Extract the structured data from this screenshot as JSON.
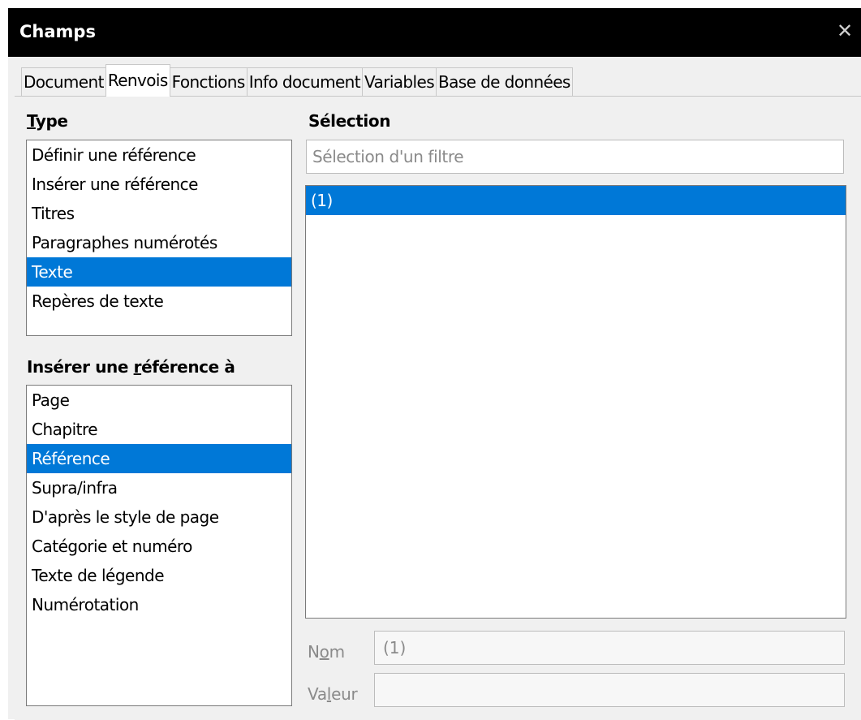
{
  "window": {
    "title": "Champs",
    "close_icon": "close-icon"
  },
  "tabs": [
    {
      "label": "Document",
      "active": false
    },
    {
      "label": "Renvois",
      "active": true
    },
    {
      "label": "Fonctions",
      "active": false
    },
    {
      "label": "Info document",
      "active": false
    },
    {
      "label": "Variables",
      "active": false
    },
    {
      "label": "Base de données",
      "active": false
    }
  ],
  "type_section": {
    "label_underlined": "T",
    "label_rest": "ype",
    "items": [
      {
        "label": "Définir une référence",
        "selected": false
      },
      {
        "label": "Insérer une référence",
        "selected": false
      },
      {
        "label": "Titres",
        "selected": false
      },
      {
        "label": "Paragraphes numérotés",
        "selected": false
      },
      {
        "label": "Texte",
        "selected": true
      },
      {
        "label": "Repères de texte",
        "selected": false
      }
    ]
  },
  "insert_ref_section": {
    "label_before": "Insérer une ",
    "label_underlined": "r",
    "label_after": "éférence à",
    "items": [
      {
        "label": "Page",
        "selected": false
      },
      {
        "label": "Chapitre",
        "selected": false
      },
      {
        "label": "Référence",
        "selected": true
      },
      {
        "label": "Supra/infra",
        "selected": false
      },
      {
        "label": "D'après le style de page",
        "selected": false
      },
      {
        "label": "Catégorie et numéro",
        "selected": false
      },
      {
        "label": "Texte de légende",
        "selected": false
      },
      {
        "label": "Numérotation",
        "selected": false
      }
    ]
  },
  "selection_section": {
    "label": "Sélection",
    "filter_placeholder": "Sélection d'un filtre",
    "items": [
      {
        "label": "(1)",
        "selected": true
      }
    ]
  },
  "fields": {
    "name_label_before": "N",
    "name_label_underlined": "o",
    "name_label_after": "m",
    "name_value": "(1)",
    "value_label_before": "Va",
    "value_label_underlined": "l",
    "value_label_after": "eur",
    "value_value": ""
  },
  "colors": {
    "selection": "#0078d7",
    "titlebar": "#000000",
    "dialog_bg": "#f0f0f0"
  }
}
